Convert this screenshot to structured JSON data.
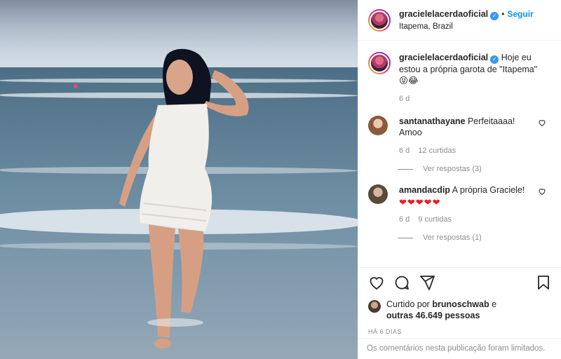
{
  "post": {
    "username": "gracielelacerdaoficial",
    "separator": "•",
    "follow_label": "Seguir",
    "location": "Itapema, Brazil",
    "verified_glyph": "✓",
    "accent_color": "#0095f6"
  },
  "caption": {
    "username": "gracielelacerdaoficial",
    "text": "Hoje eu estou a própria garota de \"Itapema\" 😝😂",
    "time": "6 d"
  },
  "comments": [
    {
      "username": "santanathayane",
      "text": "Perfeitaaaa! Amoo",
      "time": "6 d",
      "likes": "12 curtidas",
      "replies": "Ver respostas (3)"
    },
    {
      "username": "amandacdip",
      "text": "A própria Graciele!",
      "emoji": "❤❤❤❤❤",
      "time": "6 d",
      "likes": "9 curtidas",
      "replies": "Ver respostas (1)"
    }
  ],
  "likes": {
    "prefix": "Curtido por",
    "user": "brunoschwab",
    "middle": "e",
    "others": "outras 46.649 pessoas"
  },
  "timestamp": "HÁ 6 DIAS",
  "footer_text": "Os comentários nesta publicação foram limitados.",
  "icons": [
    "heart-icon",
    "comment-icon",
    "share-icon",
    "bookmark-icon"
  ]
}
